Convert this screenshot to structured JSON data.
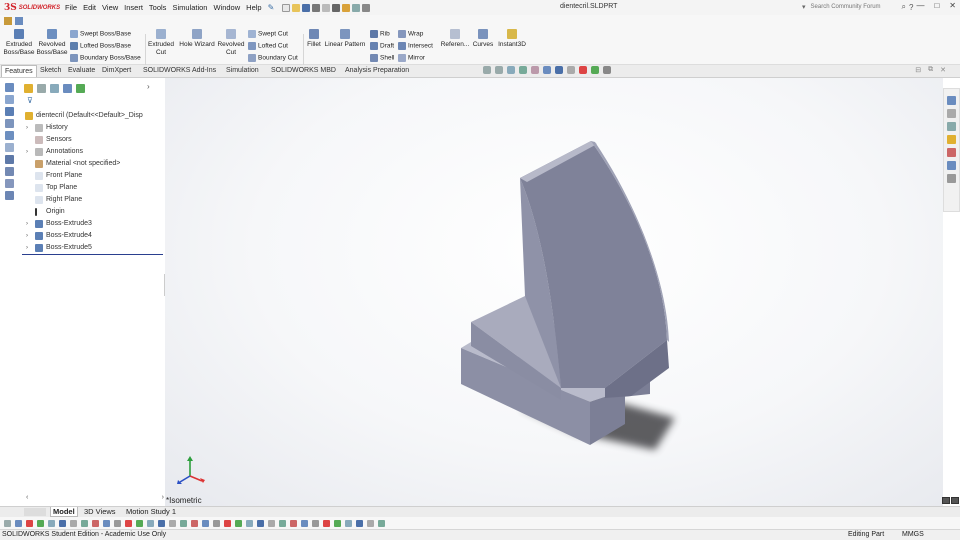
{
  "app": {
    "logo_mark": "3S",
    "logo_text": "SOLIDWORKS",
    "document_title": "dientecril.SLDPRT",
    "search_placeholder": "Search Community Forum"
  },
  "menu": [
    "File",
    "Edit",
    "View",
    "Insert",
    "Tools",
    "Simulation",
    "Window",
    "Help"
  ],
  "command_manager": {
    "extruded_boss": "Extruded Boss/Base",
    "revolved_boss": "Revolved Boss/Base",
    "swept_boss": "Swept Boss/Base",
    "lofted_boss": "Lofted Boss/Base",
    "boundary_boss": "Boundary Boss/Base",
    "extruded_cut": "Extruded Cut",
    "hole_wizard": "Hole Wizard",
    "revolved_cut": "Revolved Cut",
    "swept_cut": "Swept Cut",
    "lofted_cut": "Lofted Cut",
    "boundary_cut": "Boundary Cut",
    "fillet": "Fillet",
    "linear_pattern": "Linear Pattern",
    "rib": "Rib",
    "draft": "Draft",
    "shell": "Shell",
    "wrap": "Wrap",
    "intersect": "Intersect",
    "mirror": "Mirror",
    "reference": "Referen...",
    "curves": "Curves",
    "instant3d": "Instant3D"
  },
  "tabs": [
    "Features",
    "Sketch",
    "Evaluate",
    "DimXpert",
    "SOLIDWORKS Add-Ins",
    "Simulation",
    "SOLIDWORKS MBD",
    "Analysis Preparation"
  ],
  "tree": {
    "root": "dientecril  (Default<<Default>_Disp",
    "items": [
      "History",
      "Sensors",
      "Annotations",
      "Material <not specified>",
      "Front Plane",
      "Top Plane",
      "Right Plane",
      "Origin",
      "Boss-Extrude3",
      "Boss-Extrude4",
      "Boss-Extrude5"
    ]
  },
  "viewport": {
    "view_label": "*Isometric"
  },
  "bottom_tabs": [
    "Model",
    "3D Views",
    "Motion Study 1"
  ],
  "status": {
    "left": "SOLIDWORKS Student Edition - Academic Use Only",
    "mode": "Editing Part",
    "units": "MMGS"
  },
  "colors": {
    "brand_red": "#d2232a",
    "model_top": "#b7b9c9",
    "model_front": "#8d90a6",
    "model_side": "#6b6e87"
  }
}
